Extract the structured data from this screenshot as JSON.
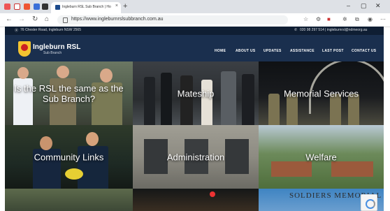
{
  "browser": {
    "tab_title": "Ingleburn RSL Sub Branch | Hon",
    "url": "https://www.ingleburnrslsubbranch.com.au",
    "win_controls": [
      "–",
      "▢",
      "✕"
    ]
  },
  "site": {
    "address": "76 Chester Road, Ingleburn NSW 2565",
    "contact": "020 98 297 514 | ingleburnrsl@ndmeorg.au",
    "brand": "Ingleburn RSL",
    "brand_sub": "Sub Branch",
    "menu": [
      "HOME",
      "ABOUT US",
      "UPDATES",
      "ASSISTANCE",
      "LAST POST",
      "CONTACT US"
    ]
  },
  "tiles": [
    {
      "caption": "Is the RSL the same as the Sub Branch?"
    },
    {
      "caption": "Mateship"
    },
    {
      "caption": "Memorial Services"
    },
    {
      "caption": "Community Links"
    },
    {
      "caption": "Administration"
    },
    {
      "caption": "Welfare"
    }
  ],
  "bottom_text": "SOLDIERS MEMORIAL",
  "colors": {
    "nav_bg": "#1a2f4e",
    "topbar_bg": "#0f1e33",
    "accent": "#f4c430"
  }
}
